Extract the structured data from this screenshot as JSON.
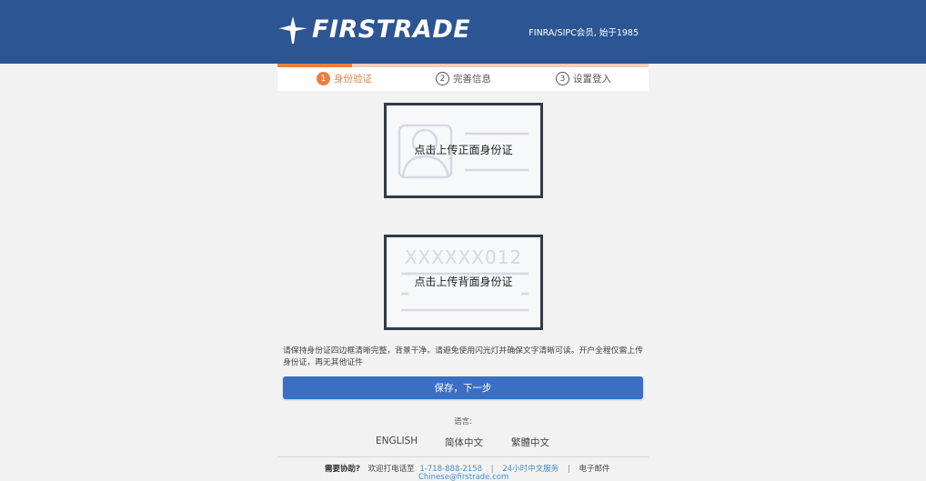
{
  "header": {
    "brand": "FIRSTRADE",
    "membership": "FINRA/SIPC会员, 始于1985"
  },
  "steps": {
    "progress_fraction": 0.2,
    "items": [
      {
        "num": "1",
        "label": "身份验证",
        "active": true
      },
      {
        "num": "2",
        "label": "完善信息",
        "active": false
      },
      {
        "num": "3",
        "label": "设置登入",
        "active": false
      }
    ]
  },
  "upload": {
    "front_label": "点击上传正面身份证",
    "back_label": "点击上传背面身份证",
    "back_sample_number": "XXXXXX012"
  },
  "notice": "请保持身份证四边框清晰完整，背景干净。请避免使用闪光灯并确保文字清晰可读。开户全程仅需上传身份证，再无其他证件",
  "primary_button": "保存，下一步",
  "language": {
    "label": "语言:",
    "options": [
      "ENGLISH",
      "简体中文",
      "繁體中文"
    ]
  },
  "help": {
    "title": "需要协助?",
    "call_text": "欢迎打电话至",
    "phone": "1-718-888-2158",
    "chat": "24小时中文服务",
    "email_label": "电子邮件",
    "email": "Chinese@firstrade.com"
  },
  "colors": {
    "header_bg": "#2c5594",
    "accent_orange": "#ea7f43",
    "button_blue": "#3a6fc5",
    "link_blue": "#4a90c8"
  }
}
